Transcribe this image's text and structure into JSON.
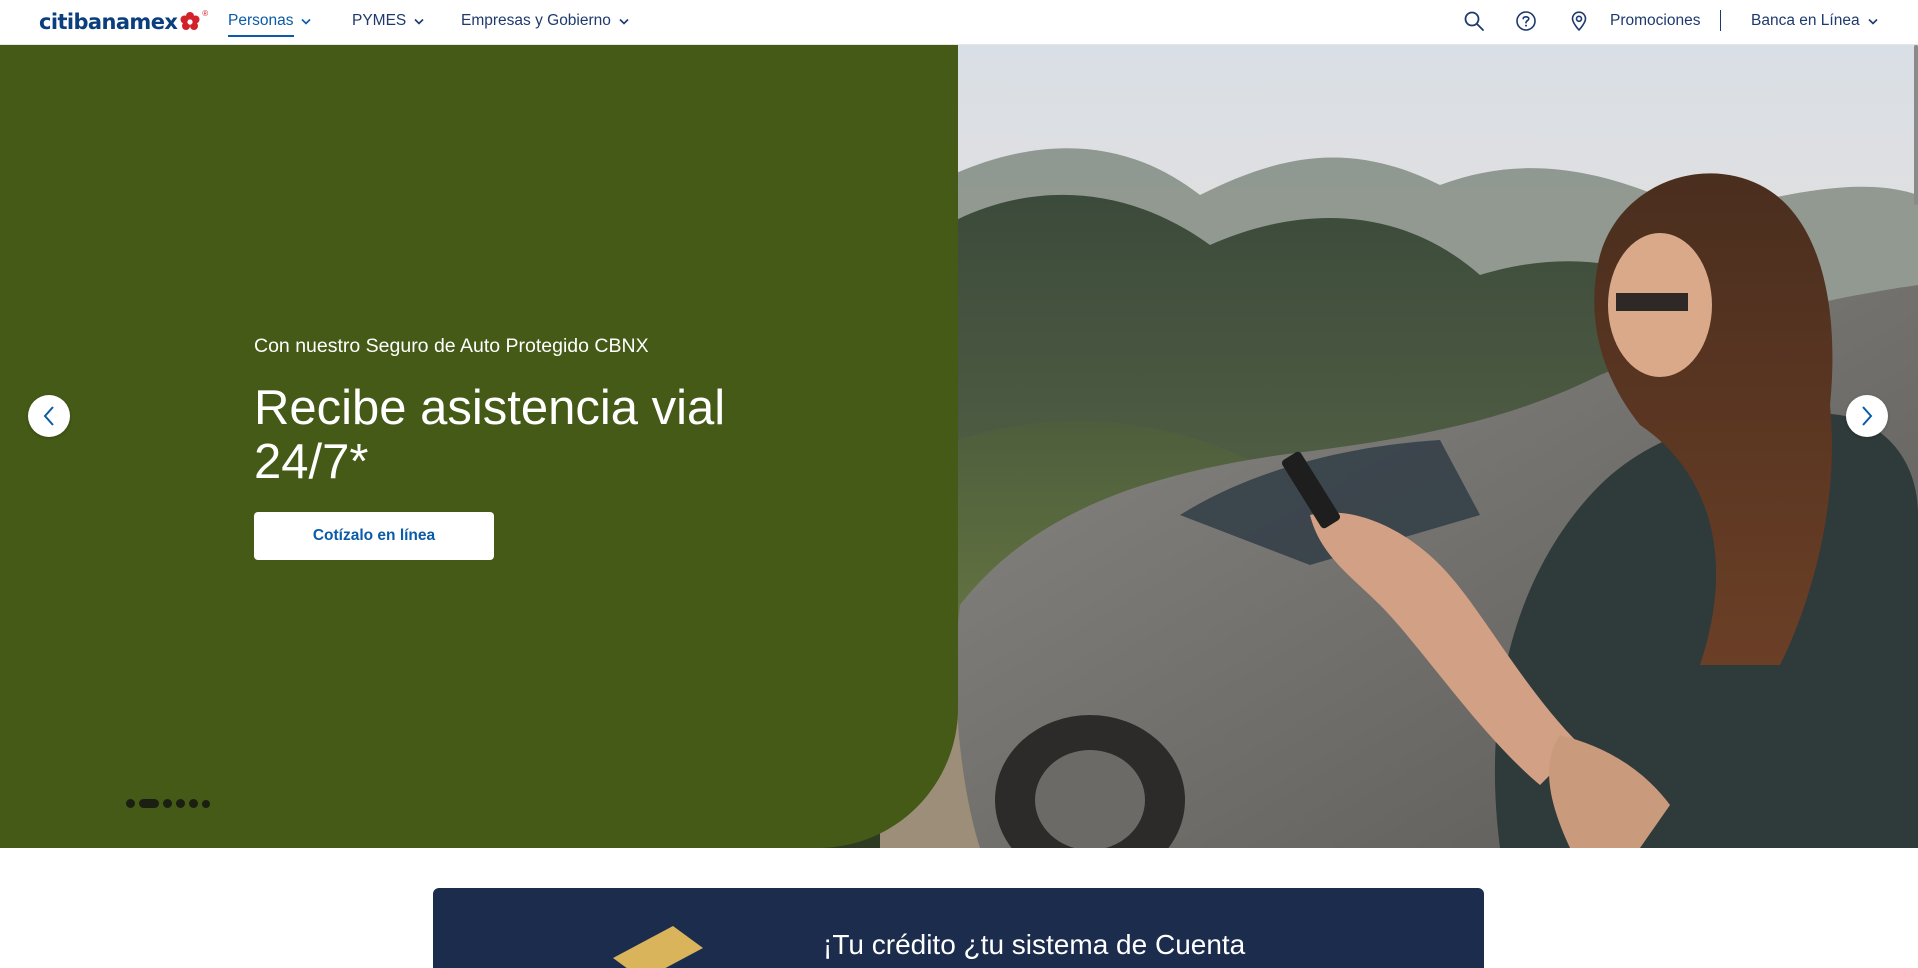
{
  "header": {
    "logo_text": "citibanamex",
    "logo_reg": "®",
    "nav": [
      {
        "label": "Personas",
        "active": true
      },
      {
        "label": "PYMES",
        "active": false
      },
      {
        "label": "Empresas y Gobierno",
        "active": false
      }
    ],
    "utility": {
      "search_icon": "search-icon",
      "help_icon": "help-circle-icon",
      "location_icon": "map-pin-icon",
      "promos_label": "Promociones",
      "banca_label": "Banca en Línea"
    }
  },
  "hero": {
    "kicker": "Con nuestro Seguro de Auto Protegido CBNX",
    "title": "Recibe asistencia vial 24/7*",
    "cta_label": "Cotízalo en línea",
    "background_color": "#445a16",
    "carousel": {
      "slide_count": 6,
      "active_index": 1
    },
    "photo_description_icon": "photo-woman-car"
  },
  "promo": {
    "title_partial": "¡Tu crédito ¿tu sistema de Cuenta"
  },
  "colors": {
    "brand_blue": "#0a3e7d",
    "link_blue": "#0a5ba8",
    "nav_text": "#1e3a6d",
    "brand_red": "#d2232a",
    "hero_green": "#445a16",
    "promo_navy": "#1b2c4d"
  }
}
